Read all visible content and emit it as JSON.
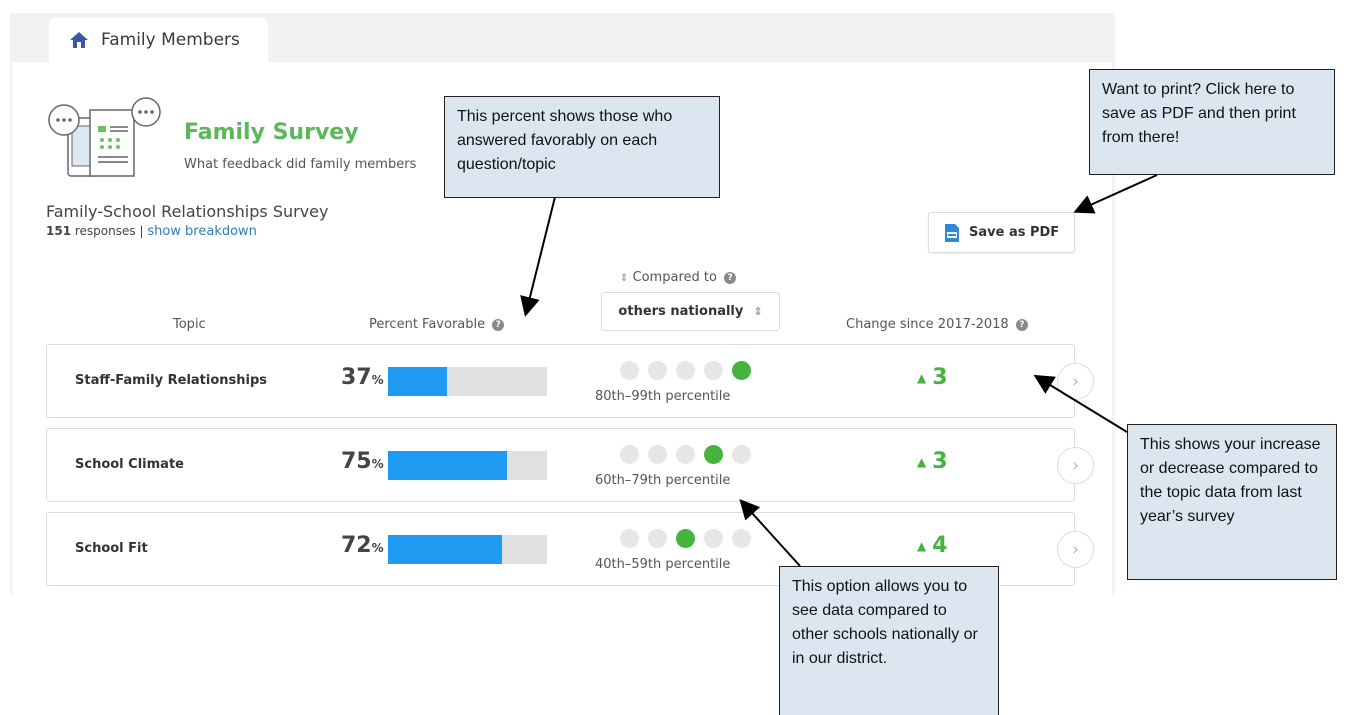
{
  "tab": {
    "label": "Family Members"
  },
  "survey": {
    "title": "Family Survey",
    "subtitle": "What feedback did family members",
    "name": "Family-School Relationships Survey",
    "response_count": "151",
    "responses_label": " responses | ",
    "breakdown_link": "show breakdown"
  },
  "save_pdf": {
    "label": "Save as PDF"
  },
  "comparison": {
    "label": "Compared to",
    "selected": "others nationally"
  },
  "columns": {
    "topic": "Topic",
    "percent_favorable": "Percent Favorable",
    "change": "Change since 2017-2018"
  },
  "topics": [
    {
      "name": "Staff-Family Relationships",
      "percent": "37",
      "percent_value": 0.37,
      "percentile_dot": 5,
      "percentile_label": "80th–99th percentile",
      "change": "3"
    },
    {
      "name": "School Climate",
      "percent": "75",
      "percent_value": 0.75,
      "percentile_dot": 4,
      "percentile_label": "60th–79th percentile",
      "change": "3"
    },
    {
      "name": "School Fit",
      "percent": "72",
      "percent_value": 0.72,
      "percentile_dot": 3,
      "percentile_label": "40th–59th percentile",
      "change": "4"
    }
  ],
  "percent_symbol": "%",
  "callouts": {
    "percent": "This percent shows those who answered favorably on each question/topic",
    "print": "Want to print? Click here to save as PDF and then print from there!",
    "change": "This shows your increase or decrease compared to the topic data from last year’s survey",
    "compare": "This option allows you to see data compared to other schools nationally or in our district."
  },
  "colors": {
    "accent_green": "#46b33f",
    "bar_blue": "#1e9bf0",
    "link_blue": "#2f7fb6",
    "callout_bg": "#dce6f1"
  },
  "icons": {
    "tab": "home-icon",
    "pdf": "pdf-file-icon",
    "row": "chevron-right-icon",
    "help": "help-icon"
  }
}
